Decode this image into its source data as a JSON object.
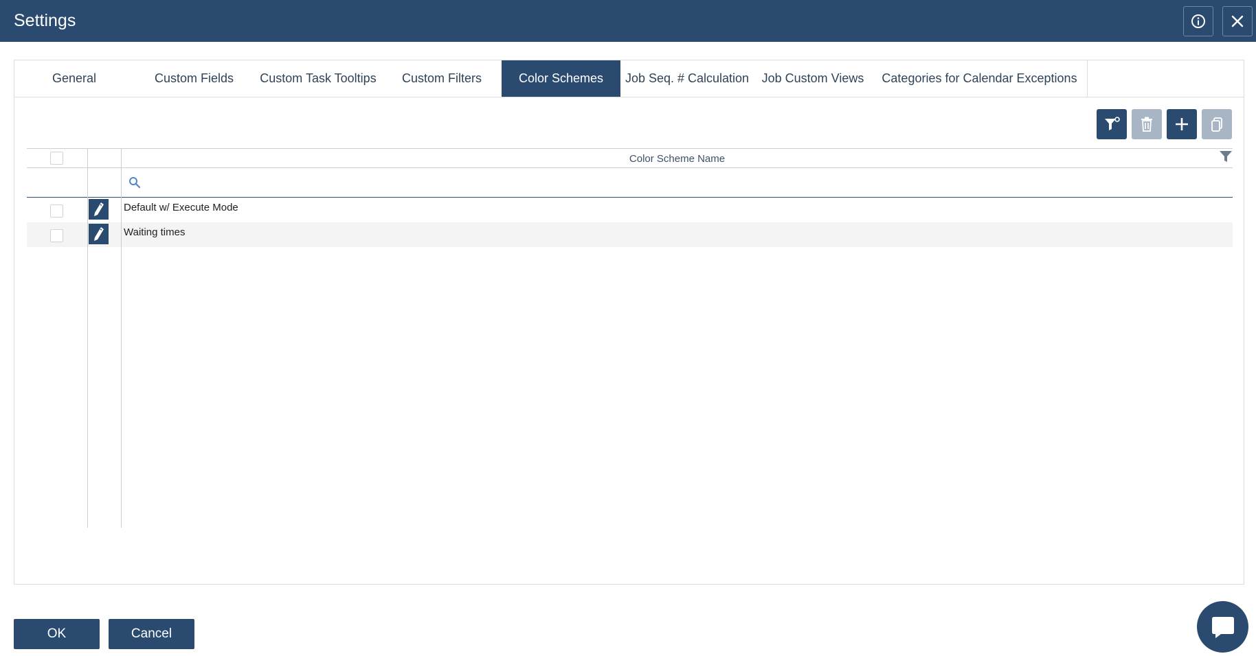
{
  "window": {
    "title": "Settings"
  },
  "tabs": [
    {
      "label": "General",
      "active": false
    },
    {
      "label": "Custom Fields",
      "active": false
    },
    {
      "label": "Custom Task Tooltips",
      "active": false
    },
    {
      "label": "Custom Filters",
      "active": false
    },
    {
      "label": "Color Schemes",
      "active": true
    },
    {
      "label": "Job Seq. # Calculation",
      "active": false
    },
    {
      "label": "Job Custom Views",
      "active": false
    },
    {
      "label": "Categories for Calendar Exceptions",
      "active": false
    }
  ],
  "toolbar": {
    "buttons": [
      {
        "name": "filter-settings",
        "icon": "filter-gear-icon",
        "enabled": true
      },
      {
        "name": "delete",
        "icon": "trash-icon",
        "enabled": false
      },
      {
        "name": "add",
        "icon": "plus-icon",
        "enabled": true
      },
      {
        "name": "copy",
        "icon": "copy-icon",
        "enabled": false
      }
    ]
  },
  "grid": {
    "column_header": "Color Scheme Name",
    "filter_placeholder": "",
    "rows": [
      {
        "name": "Default w/ Execute Mode"
      },
      {
        "name": "Waiting times"
      }
    ]
  },
  "footer": {
    "ok_label": "OK",
    "cancel_label": "Cancel"
  },
  "colors": {
    "primary": "#2b4a6f",
    "disabled": "#a8b5c4",
    "border": "#d9dde2",
    "alt_row": "#f4f4f4"
  }
}
